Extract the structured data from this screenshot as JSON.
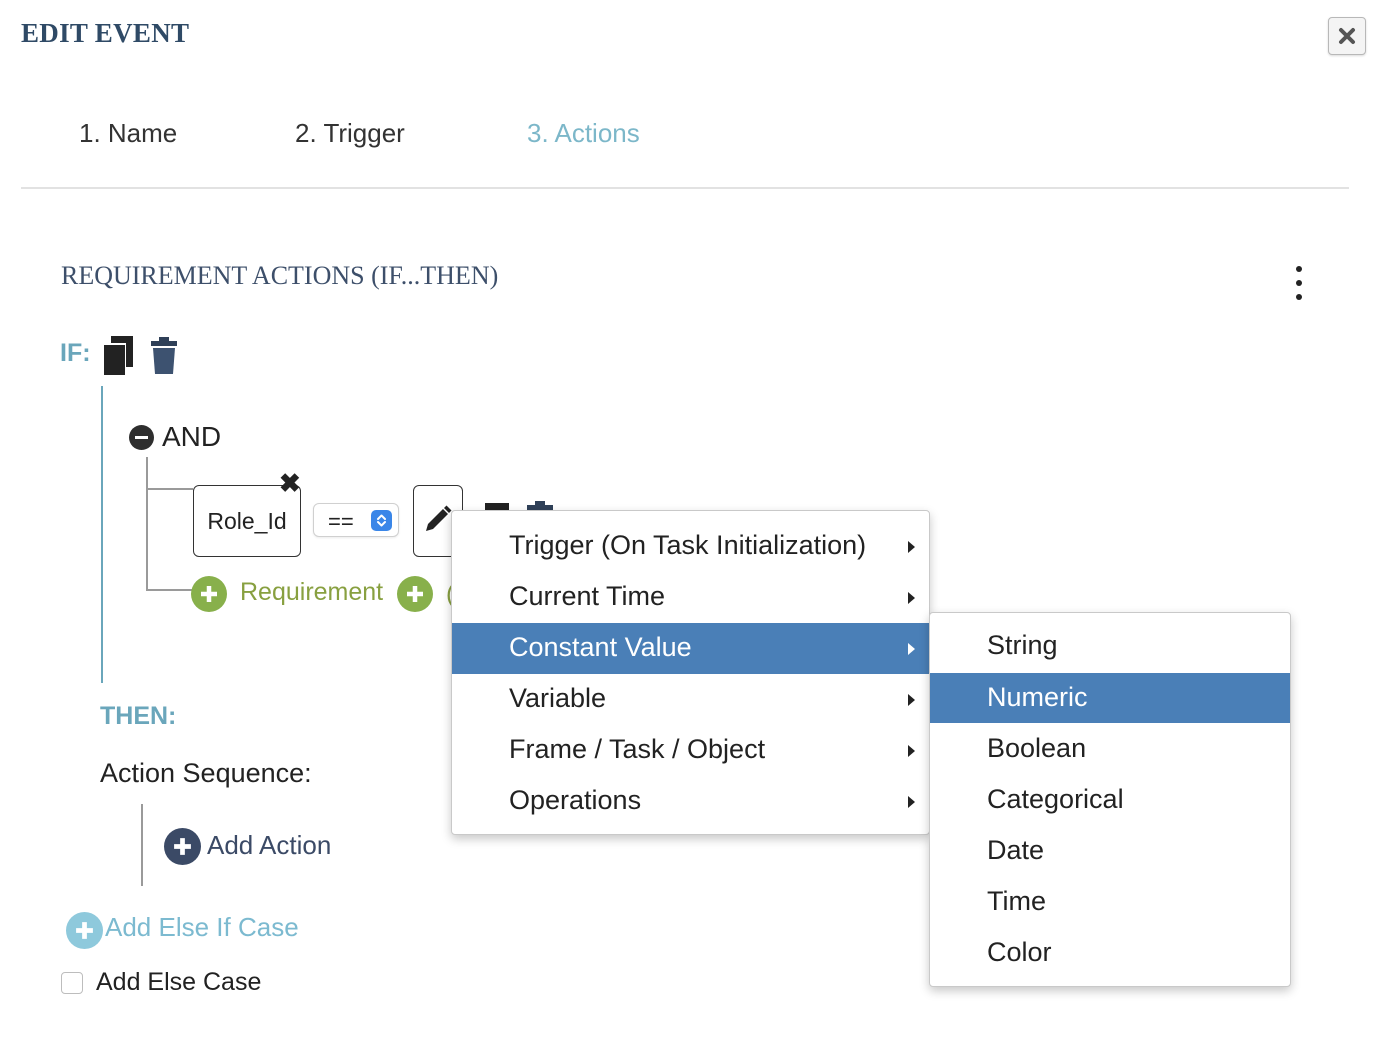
{
  "dialog": {
    "title": "EDIT EVENT"
  },
  "tabs": [
    {
      "label": "1. Name",
      "active": false
    },
    {
      "label": "2. Trigger",
      "active": false
    },
    {
      "label": "3. Actions",
      "active": true
    }
  ],
  "section": {
    "title": "REQUIREMENT ACTIONS (IF...THEN)"
  },
  "if_block": {
    "label": "IF:",
    "group_operator": "AND",
    "condition": {
      "left_operand": "Role_Id",
      "operator": "=="
    },
    "add_requirement_label": "Requirement"
  },
  "then_block": {
    "label": "THEN:",
    "action_sequence_label": "Action Sequence:",
    "add_action_label": "Add Action"
  },
  "add_else_if_label": "Add Else If Case",
  "add_else_case": {
    "label": "Add Else Case",
    "checked": false
  },
  "menu_primary": {
    "items": [
      {
        "label": "Trigger (On Task Initialization)",
        "highlighted": false
      },
      {
        "label": "Current Time",
        "highlighted": false
      },
      {
        "label": "Constant Value",
        "highlighted": true
      },
      {
        "label": "Variable",
        "highlighted": false
      },
      {
        "label": "Frame / Task / Object",
        "highlighted": false
      },
      {
        "label": "Operations",
        "highlighted": false
      }
    ]
  },
  "menu_submenu": {
    "items": [
      {
        "label": "String",
        "highlighted": false
      },
      {
        "label": "Numeric",
        "highlighted": true
      },
      {
        "label": "Boolean",
        "highlighted": false
      },
      {
        "label": "Categorical",
        "highlighted": false
      },
      {
        "label": "Date",
        "highlighted": false
      },
      {
        "label": "Time",
        "highlighted": false
      },
      {
        "label": "Color",
        "highlighted": false
      }
    ]
  },
  "colors": {
    "accent_teal": "#6aa6bb",
    "active_tab": "#7cb7c9",
    "requirement_green": "#88b04b",
    "menu_highlight": "#4a7fb7",
    "title_navy": "#2f4a66"
  },
  "icons": [
    "close-icon",
    "kebab-menu-icon",
    "copy-icon",
    "trash-icon",
    "minus-circle-icon",
    "close-x-icon",
    "select-arrows-icon",
    "pencil-icon",
    "plus-circle-icon",
    "chevron-right-icon"
  ]
}
